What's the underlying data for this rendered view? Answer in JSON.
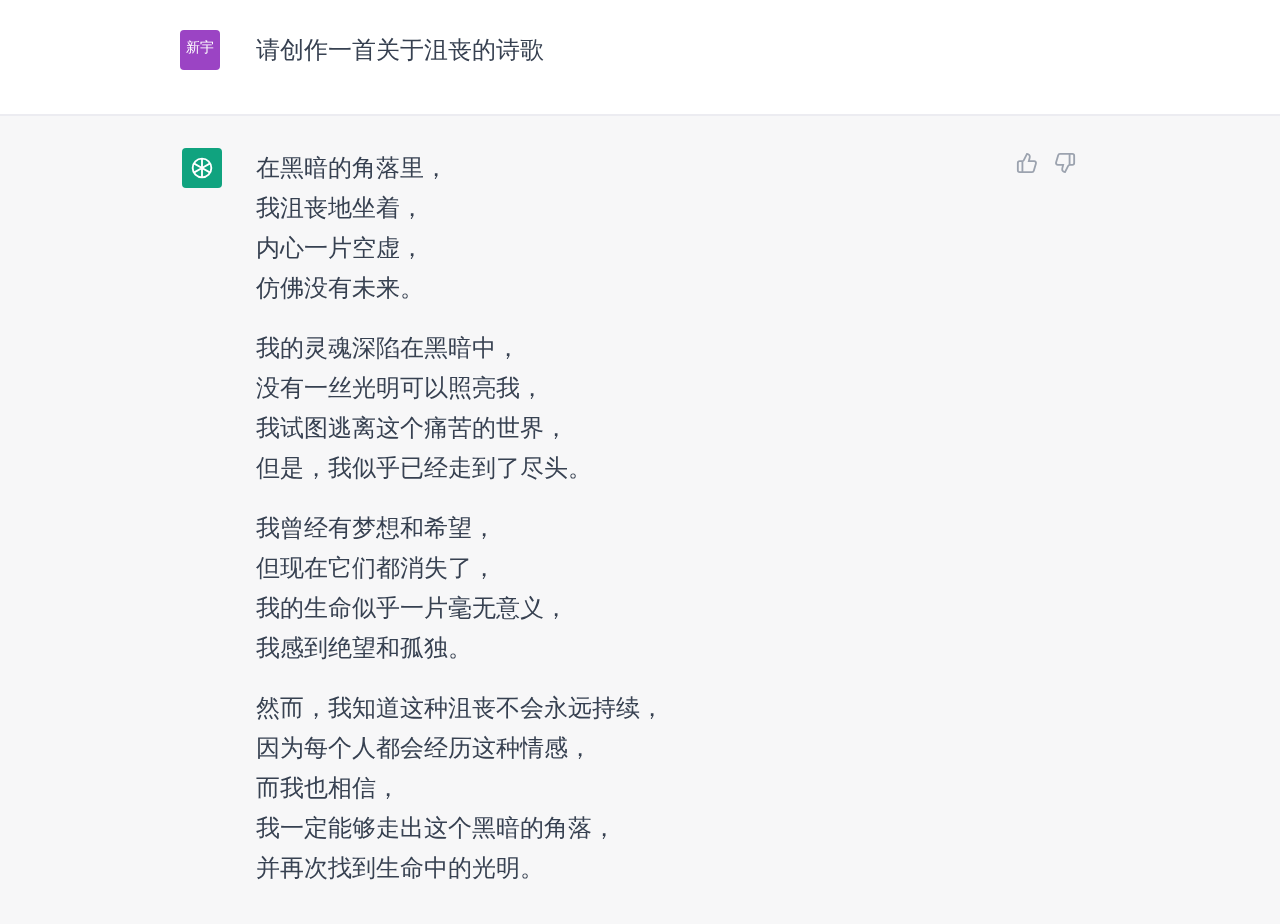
{
  "user_message": {
    "avatar": "新宇",
    "text": "请创作一首关于沮丧的诗歌"
  },
  "assistant_message": {
    "stanzas": [
      [
        "在黑暗的角落里，",
        "我沮丧地坐着，",
        "内心一片空虚，",
        "仿佛没有未来。"
      ],
      [
        "我的灵魂深陷在黑暗中，",
        "没有一丝光明可以照亮我，",
        "我试图逃离这个痛苦的世界，",
        "但是，我似乎已经走到了尽头。"
      ],
      [
        "我曾经有梦想和希望，",
        "但现在它们都消失了，",
        "我的生命似乎一片毫无意义，",
        "我感到绝望和孤独。"
      ],
      [
        "然而，我知道这种沮丧不会永远持续，",
        "因为每个人都会经历这种情感，",
        "而我也相信，",
        "我一定能够走出这个黑暗的角落，",
        "并再次找到生命中的光明。"
      ]
    ]
  }
}
